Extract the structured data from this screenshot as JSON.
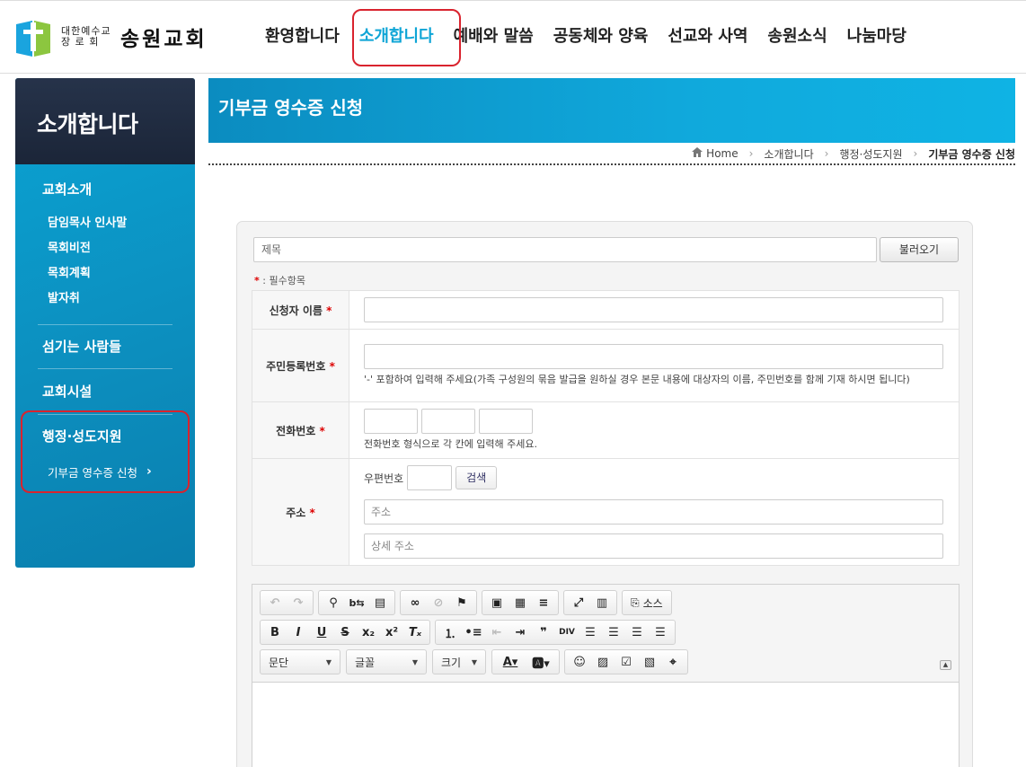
{
  "header": {
    "logo_small": "대한예수교 장 로 회",
    "logo_big": "송원교회",
    "nav": [
      {
        "label": "환영합니다"
      },
      {
        "label": "소개합니다"
      },
      {
        "label": "예배와 말씀"
      },
      {
        "label": "공동체와 양육"
      },
      {
        "label": "선교와 사역"
      },
      {
        "label": "송원소식"
      },
      {
        "label": "나눔마당"
      }
    ],
    "active_nav": "소개합니다"
  },
  "sidebar": {
    "title": "소개합니다",
    "sections": [
      {
        "label": "교회소개",
        "items": [
          "담임목사 인사말",
          "목회비전",
          "목회계획",
          "발자취"
        ]
      },
      {
        "label": "섬기는 사람들"
      },
      {
        "label": "교회시설"
      },
      {
        "label": "행정·성도지원",
        "items": [
          "기부금 영수증 신청"
        ]
      }
    ],
    "current_chevron": "›"
  },
  "page": {
    "title": "기부금 영수증 신청",
    "breadcrumb": [
      "Home",
      "소개합니다",
      "행정·성도지원",
      "기부금 영수증 신청"
    ]
  },
  "form": {
    "title_placeholder": "제목",
    "load_button": "불러오기",
    "required_note_star": "*",
    "required_note": " : 필수항목",
    "fields": {
      "name_label": "신청자 이름",
      "ssn_label": "주민등록번호",
      "ssn_help": "'-' 포함하여 입력해 주세요(가족 구성원의 묶음 발급을 원하실 경우 본문 내용에 대상자의 이름, 주민번호를 함께 기재 하시면 됩니다)",
      "phone_label": "전화번호",
      "phone_help": "전화번호 형식으로 각 칸에 입력해 주세요.",
      "address_label": "주소",
      "zip_label": "우편번호",
      "search_button": "검색",
      "address_placeholder": "주소",
      "address_detail_placeholder": "상세 주소"
    },
    "star": "*"
  },
  "editor": {
    "source_label": "소스",
    "combos": {
      "paragraph": "문단",
      "font": "글꼴",
      "size": "크기"
    },
    "toolbar_icons": [
      "undo-icon",
      "redo-icon",
      "find-icon",
      "replace-icon",
      "paste-icon",
      "link-icon",
      "unlink-icon",
      "anchor-icon",
      "image-icon",
      "table-icon",
      "hr-icon",
      "maximize-icon",
      "blocks-icon",
      "source-icon",
      "bold-icon",
      "italic-icon",
      "underline-icon",
      "strike-icon",
      "subscript-icon",
      "superscript-icon",
      "remove-format-icon",
      "numbered-list-icon",
      "bulleted-list-icon",
      "outdent-icon",
      "indent-icon",
      "blockquote-icon",
      "div-icon",
      "align-left-icon",
      "align-center-icon",
      "align-right-icon",
      "justify-icon",
      "text-color-icon",
      "bg-color-icon",
      "smiley-icon",
      "image2-icon",
      "checkbox-icon",
      "gallery-icon",
      "map-icon"
    ]
  },
  "colors": {
    "accent": "#0ea5d6",
    "sidebar_top": "#1b2538",
    "highlight": "#d9232e"
  }
}
